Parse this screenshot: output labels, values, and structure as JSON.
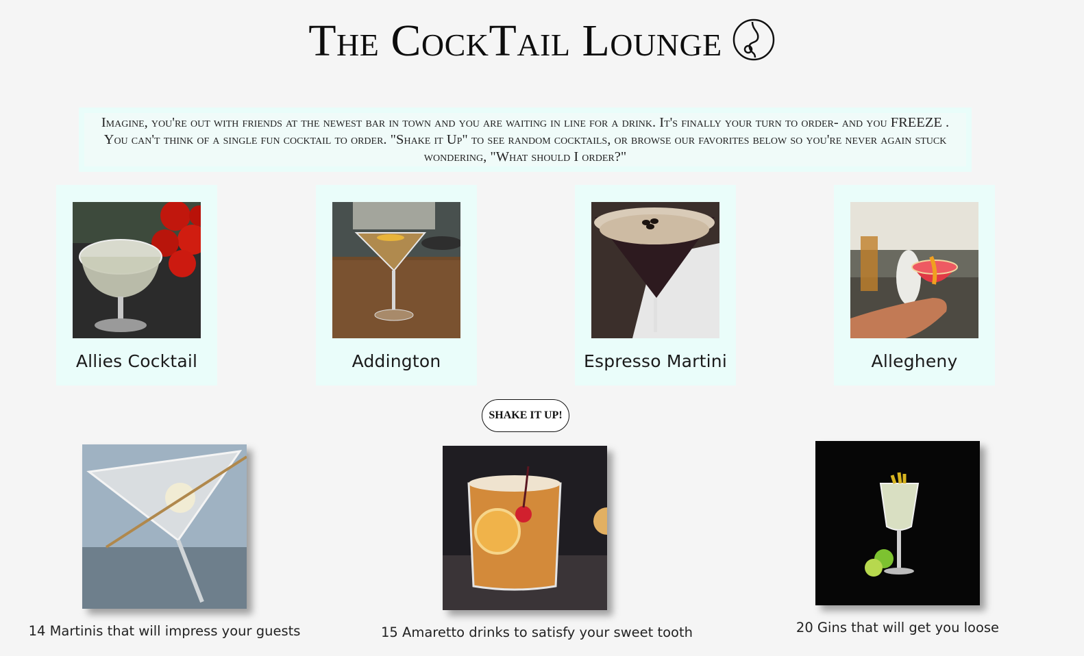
{
  "header": {
    "title": "The CockTail Lounge",
    "logo_icon": "music-note-circle-icon"
  },
  "intro": {
    "text": "Imagine, you're out with friends at the newest bar in town and you are waiting in line for a drink. It's finally your turn to order- and you FREEZE . You can't think of a single fun cocktail to order. \"Shake it Up\" to see random cocktails, or browse our favorites below so you're never again stuck wondering, \"What should I order?\""
  },
  "cocktails": [
    {
      "name": "Allies Cocktail"
    },
    {
      "name": "Addington"
    },
    {
      "name": "Espresso Martini"
    },
    {
      "name": "Allegheny"
    }
  ],
  "shake_button": {
    "label": "SHAKE IT UP!"
  },
  "features": [
    {
      "caption": "14 Martinis that will impress your guests"
    },
    {
      "caption": "15 Amaretto drinks to satisfy your sweet tooth"
    },
    {
      "caption": "20 Gins that will get you loose"
    }
  ],
  "colors": {
    "background": "#f5f5f5",
    "card_background": "#eafdfa",
    "text": "#111111"
  }
}
